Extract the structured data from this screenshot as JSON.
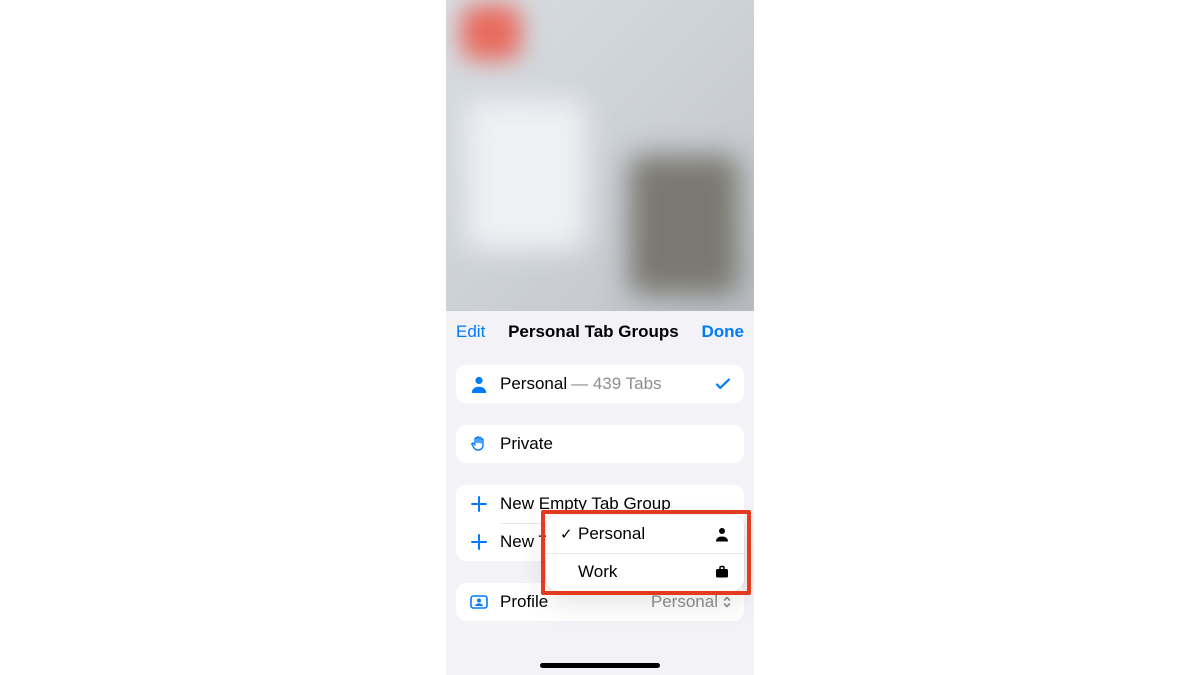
{
  "header": {
    "edit_label": "Edit",
    "title": "Personal Tab Groups",
    "done_label": "Done"
  },
  "groups": {
    "personal": {
      "name": "Personal",
      "tabs_suffix": " — 439 Tabs"
    },
    "private": {
      "name": "Private"
    }
  },
  "actions": {
    "new_empty": "New Empty Tab Group",
    "new_from": "New T"
  },
  "profile_row": {
    "label": "Profile",
    "value": "Personal"
  },
  "popup": {
    "personal": "Personal",
    "work": "Work"
  }
}
